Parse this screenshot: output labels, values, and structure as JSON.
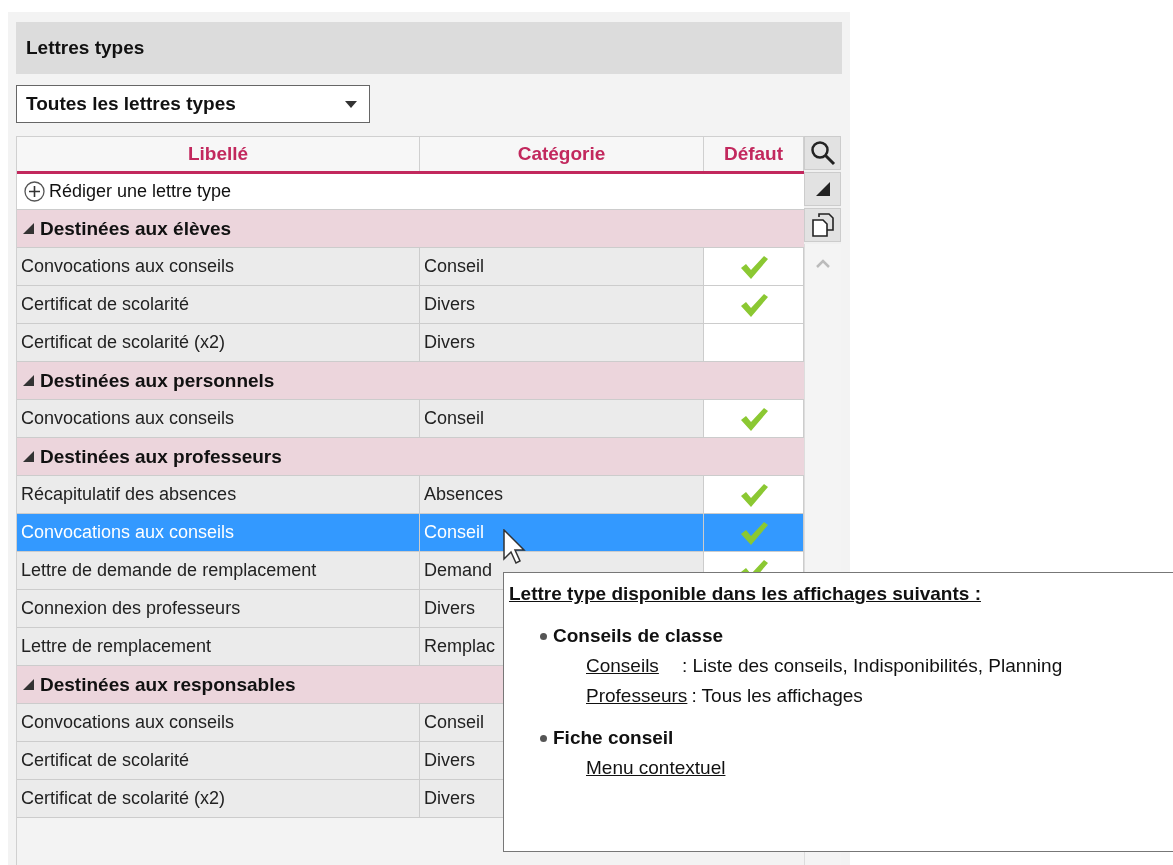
{
  "panel": {
    "title": "Lettres types"
  },
  "filter": {
    "value": "Toutes les lettres types"
  },
  "table": {
    "columns": [
      "Libellé",
      "Catégorie",
      "Défaut"
    ],
    "add_row": "Rédiger une lettre type",
    "groups": [
      {
        "label": "Destinées aux élèves",
        "expanded": true,
        "rows": [
          {
            "label": "Convocations aux conseils",
            "category": "Conseil",
            "default": true,
            "selected": false
          },
          {
            "label": "Certificat de scolarité",
            "category": "Divers",
            "default": true,
            "selected": false
          },
          {
            "label": "Certificat de scolarité (x2)",
            "category": "Divers",
            "default": false,
            "selected": false
          }
        ]
      },
      {
        "label": "Destinées aux personnels",
        "expanded": true,
        "rows": [
          {
            "label": "Convocations aux conseils",
            "category": "Conseil",
            "default": true,
            "selected": false
          }
        ]
      },
      {
        "label": "Destinées aux professeurs",
        "expanded": true,
        "rows": [
          {
            "label": "Récapitulatif des absences",
            "category": "Absences",
            "default": true,
            "selected": false
          },
          {
            "label": "Convocations aux conseils",
            "category": "Conseil",
            "default": true,
            "selected": true
          },
          {
            "label": "Lettre de demande de remplacement",
            "category": "Demand",
            "default": true,
            "selected": false
          },
          {
            "label": "Connexion des professeurs",
            "category": "Divers",
            "selected": false
          },
          {
            "label": "Lettre de remplacement",
            "category": "Remplac",
            "selected": false
          }
        ]
      },
      {
        "label": "Destinées aux responsables",
        "expanded": true,
        "rows": [
          {
            "label": "Convocations aux conseils",
            "category": "Conseil",
            "selected": false
          },
          {
            "label": "Certificat de scolarité",
            "category": "Divers",
            "selected": false
          },
          {
            "label": "Certificat de scolarité (x2)",
            "category": "Divers",
            "selected": false
          }
        ]
      }
    ]
  },
  "tooltip": {
    "title": "Lettre type disponible dans les affichages suivants :",
    "sections": [
      {
        "heading": "Conseils de classe",
        "entries": [
          {
            "link": "Conseils",
            "text": ": Liste des conseils, Indisponibilités, Planning"
          },
          {
            "link": "Professeurs",
            "text": ": Tous les affichages"
          }
        ]
      },
      {
        "heading": "Fiche conseil",
        "entries": [
          {
            "link": "Menu contextuel"
          }
        ]
      }
    ]
  }
}
